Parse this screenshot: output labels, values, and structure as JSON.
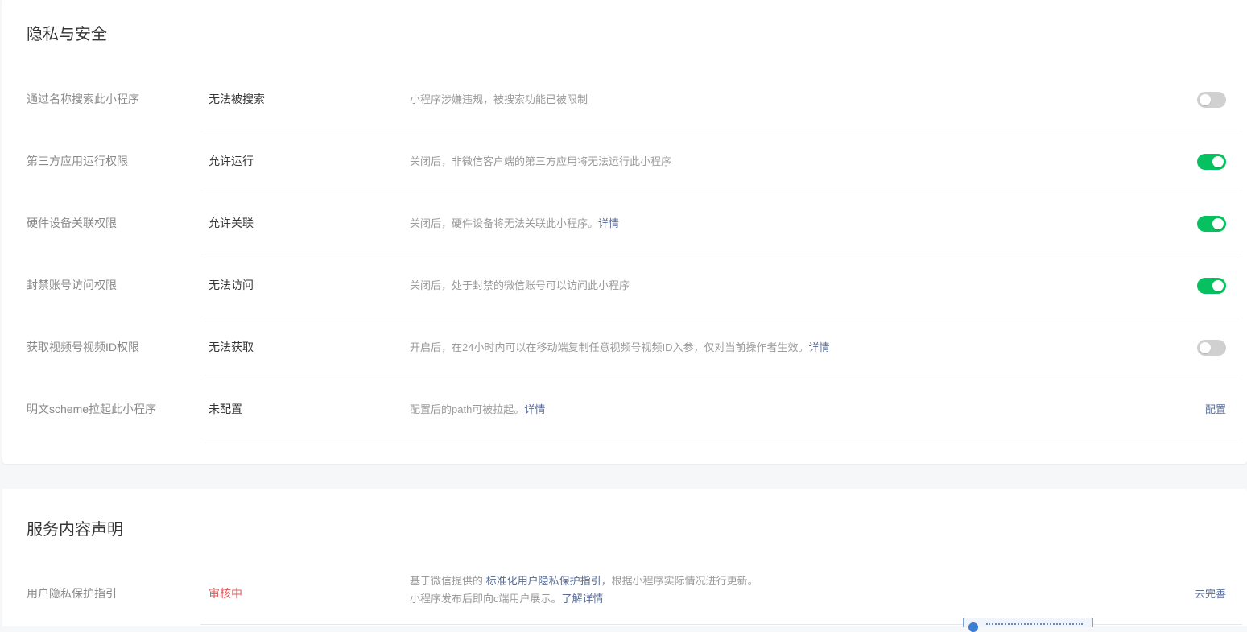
{
  "privacy": {
    "title": "隐私与安全",
    "rows": [
      {
        "label": "通过名称搜索此小程序",
        "status": "无法被搜索",
        "desc": "小程序涉嫌违规，被搜索功能已被限制",
        "toggle_on": false
      },
      {
        "label": "第三方应用运行权限",
        "status": "允许运行",
        "desc": "关闭后，非微信客户端的第三方应用将无法运行此小程序",
        "toggle_on": true
      },
      {
        "label": "硬件设备关联权限",
        "status": "允许关联",
        "desc": "关闭后，硬件设备将无法关联此小程序。",
        "desc_link": "详情",
        "toggle_on": true
      },
      {
        "label": "封禁账号访问权限",
        "status": "无法访问",
        "desc": "关闭后，处于封禁的微信账号可以访问此小程序",
        "toggle_on": true
      },
      {
        "label": "获取视频号视频ID权限",
        "status": "无法获取",
        "desc": "开启后，在24小时内可以在移动端复制任意视频号视频ID入参，仅对当前操作者生效。",
        "desc_link": "详情",
        "toggle_on": false
      },
      {
        "label": "明文scheme拉起此小程序",
        "status": "未配置",
        "desc": "配置后的path可被拉起。",
        "desc_link": "详情",
        "action": "配置"
      }
    ]
  },
  "service": {
    "title": "服务内容声明",
    "rows": [
      {
        "label": "用户隐私保护指引",
        "status": "审核中",
        "desc_line1_prefix": "基于微信提供的",
        "desc_line1_link": "标准化用户隐私保护指引",
        "desc_line1_suffix": "，根据小程序实际情况进行更新。",
        "desc_line2": "小程序发布后即向c端用户展示。",
        "desc_line2_link": "了解详情",
        "action": "去完善"
      }
    ]
  },
  "colors": {
    "toggle_on": "#07c160",
    "toggle_off": "#d0d0d0",
    "link": "#576b95",
    "pending": "#e15f5f"
  }
}
